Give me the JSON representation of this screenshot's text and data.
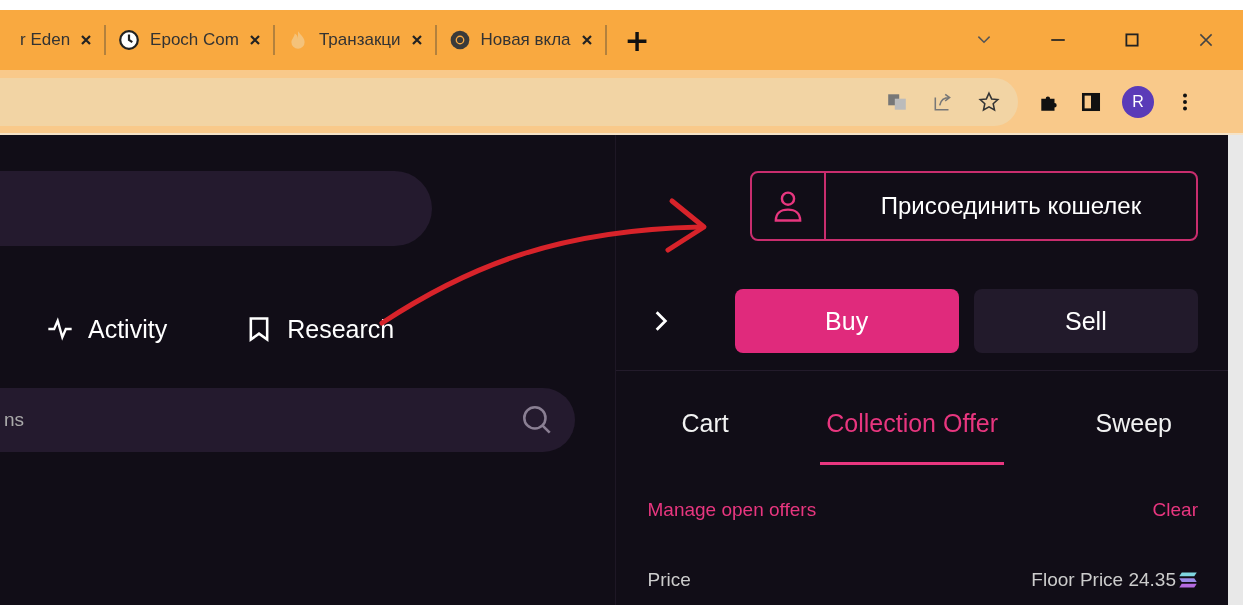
{
  "browser": {
    "tabs": [
      {
        "title": "r Eden",
        "selected": false,
        "kind": "plain"
      },
      {
        "title": "Epoch Com",
        "selected": false,
        "kind": "clock"
      },
      {
        "title": "Транзакци",
        "selected": false,
        "kind": "flame"
      },
      {
        "title": "Новая вкла",
        "selected": false,
        "kind": "chrome"
      }
    ],
    "new_tab": "+",
    "profile": "R"
  },
  "page": {
    "nav": [
      {
        "label": "Activity",
        "kind": "activity"
      },
      {
        "label": "Research",
        "kind": "bookmark"
      }
    ],
    "search": {
      "placeholder": "ns"
    },
    "connect_wallet": "Присоединить кошелек",
    "trade": [
      {
        "label": "Buy",
        "selected": true
      },
      {
        "label": "Sell",
        "selected": false
      }
    ],
    "tabs": [
      {
        "label": "Cart",
        "selected": false
      },
      {
        "label": "Collection Offer",
        "selected": true
      },
      {
        "label": "Sweep",
        "selected": false
      }
    ],
    "manage_offers": "Manage open offers",
    "clear": "Clear",
    "price_label": "Price",
    "floor_price": "Floor Price 24.35"
  }
}
